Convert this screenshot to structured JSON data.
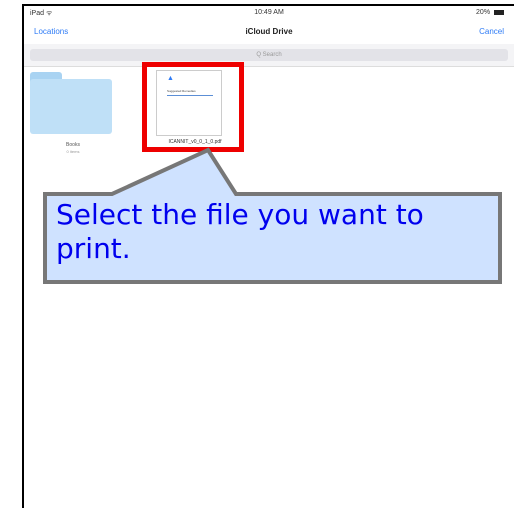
{
  "status_bar": {
    "carrier": "iPad ᯤ",
    "time": "10:49 AM",
    "battery": "20%"
  },
  "nav": {
    "left_label": "Locations",
    "title": "iCloud Drive",
    "right_label": "Cancel"
  },
  "search": {
    "placeholder": "Q Search"
  },
  "items": [
    {
      "name": "Books",
      "subtitle": "0 items",
      "kind": "folder"
    },
    {
      "name": "ICANNIT_v0_0_1_0.pdf",
      "kind": "pdf"
    }
  ],
  "doc_preview": {
    "text": "Suggested Remedies"
  },
  "callout": {
    "text": "Select the file you want to print."
  },
  "colors": {
    "accent": "#2f7cf6",
    "highlight": "#ee0000",
    "callout_fill": "#cfe2ff",
    "callout_text": "#0000ee"
  }
}
